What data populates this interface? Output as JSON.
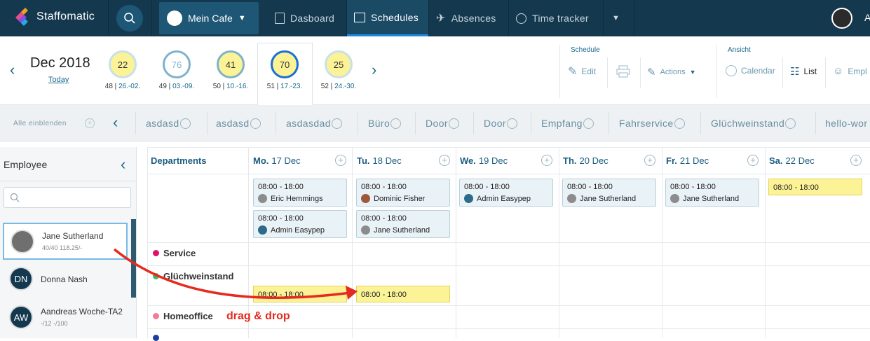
{
  "nav": {
    "brand": "Staffomatic",
    "location": "Mein Cafe",
    "items": [
      {
        "label": "Dasboard"
      },
      {
        "label": "Schedules"
      },
      {
        "label": "Absences"
      },
      {
        "label": "Time tracker"
      }
    ],
    "user_initial": "A"
  },
  "header": {
    "month": "Dec 2018",
    "today": "Today",
    "weeks": [
      {
        "value": "22",
        "num": "48",
        "range": "26.-02."
      },
      {
        "value": "76",
        "num": "49",
        "range": "03.-09."
      },
      {
        "value": "41",
        "num": "50",
        "range": "10.-16."
      },
      {
        "value": "70",
        "num": "51",
        "range": "17.-23."
      },
      {
        "value": "25",
        "num": "52",
        "range": "24.-30."
      }
    ],
    "schedule_group": "Schedule",
    "edit": "Edit",
    "actions": "Actions",
    "view_group": "Ansicht",
    "calendar": "Calendar",
    "list": "List",
    "employees_partial": "Empl"
  },
  "departments_strip": {
    "show_all": "Alle einblenden",
    "items": [
      "asdasd",
      "asdasd",
      "asdasdad",
      "Büro",
      "Door",
      "Door",
      "Empfang",
      "Fahrservice",
      "Glüchweinstand",
      "hello-wor"
    ]
  },
  "sidebar": {
    "title": "Employee",
    "employees": [
      {
        "name": "Jane Sutherland",
        "stats": "40/40 118.25/-",
        "initials": ""
      },
      {
        "name": "Donna Nash",
        "stats": "",
        "initials": "DN"
      },
      {
        "name": "Aandreas Woche-TA2",
        "stats": "-/12 -/100",
        "initials": "AW"
      }
    ]
  },
  "grid": {
    "departments_header": "Departments",
    "days": [
      {
        "dow": "Mo.",
        "date": "17 Dec"
      },
      {
        "dow": "Tu.",
        "date": "18 Dec"
      },
      {
        "dow": "We.",
        "date": "19 Dec"
      },
      {
        "dow": "Th.",
        "date": "20 Dec"
      },
      {
        "dow": "Fr.",
        "date": "21 Dec"
      },
      {
        "dow": "Sa.",
        "date": "22 Dec"
      }
    ],
    "shifts": [
      {
        "time": "08:00 - 18:00",
        "person": "Eric Hemmings"
      },
      {
        "time": "08:00 - 18:00",
        "person": "Admin Easypep"
      },
      {
        "time": "08:00 - 18:00",
        "person": "Dominic Fisher"
      },
      {
        "time": "08:00 - 18:00",
        "person": "Jane Sutherland"
      },
      {
        "time": "08:00 - 18:00",
        "person": "Admin Easypep"
      },
      {
        "time": "08:00 - 18:00",
        "person": "Jane Sutherland"
      },
      {
        "time": "08:00 - 18:00",
        "person": "Jane Sutherland"
      }
    ],
    "open_shift": "08:00 - 18:00",
    "dep_rows": [
      {
        "label": "Service",
        "color": "#e0106b"
      },
      {
        "label": "Glüchweinstand",
        "color": "#3fb862"
      },
      {
        "label": "Homeoffice",
        "color": "#f27b97"
      }
    ],
    "glueh_shift_mo": "08:00 - 18:00",
    "glueh_shift_tu": "08:00 - 18:00"
  },
  "annotation": {
    "drag_drop": "drag & drop"
  }
}
